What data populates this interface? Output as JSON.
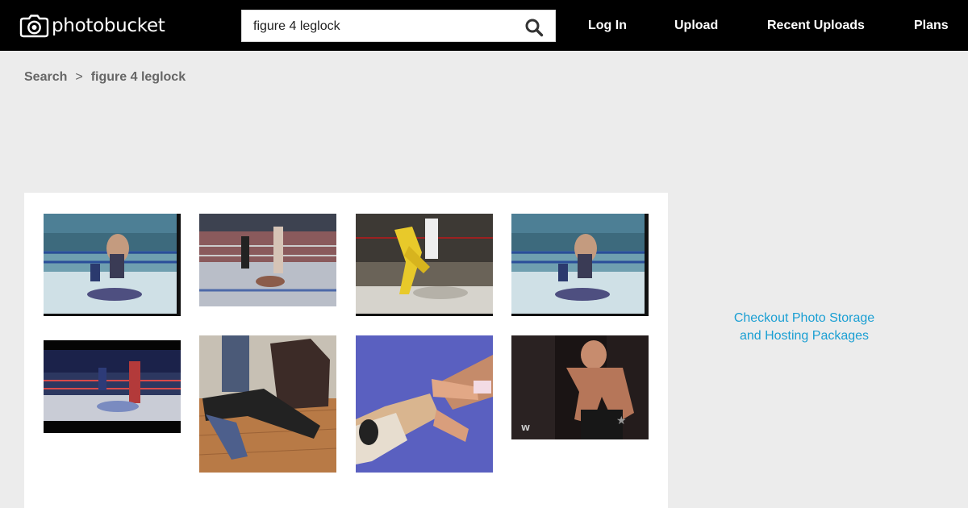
{
  "header": {
    "logo_text": "photobucket",
    "search": {
      "value": "figure 4 leglock",
      "placeholder": ""
    },
    "nav": [
      "Log In",
      "Upload",
      "Recent Uploads",
      "Plans"
    ]
  },
  "breadcrumb": {
    "root": "Search",
    "separator": ">",
    "current": "figure 4 leglock"
  },
  "promo": {
    "line1": "Checkout Photo Storage",
    "line2": "and Hosting Packages"
  },
  "colors": {
    "header_bg": "#000000",
    "page_bg": "#ececec",
    "panel_bg": "#ffffff",
    "promo_link": "#1a9fd3"
  },
  "results": [
    {
      "scene": "wrestling-ring-blue-ropes"
    },
    {
      "scene": "wrestling-ring-crowd-referee"
    },
    {
      "scene": "wrestling-ring-yellow-pants"
    },
    {
      "scene": "wrestling-ring-blue-ropes"
    },
    {
      "scene": "wrestling-arena-dark"
    },
    {
      "scene": "living-room-floor"
    },
    {
      "scene": "blue-mat-leglock"
    },
    {
      "scene": "backstage-wrestler"
    }
  ]
}
